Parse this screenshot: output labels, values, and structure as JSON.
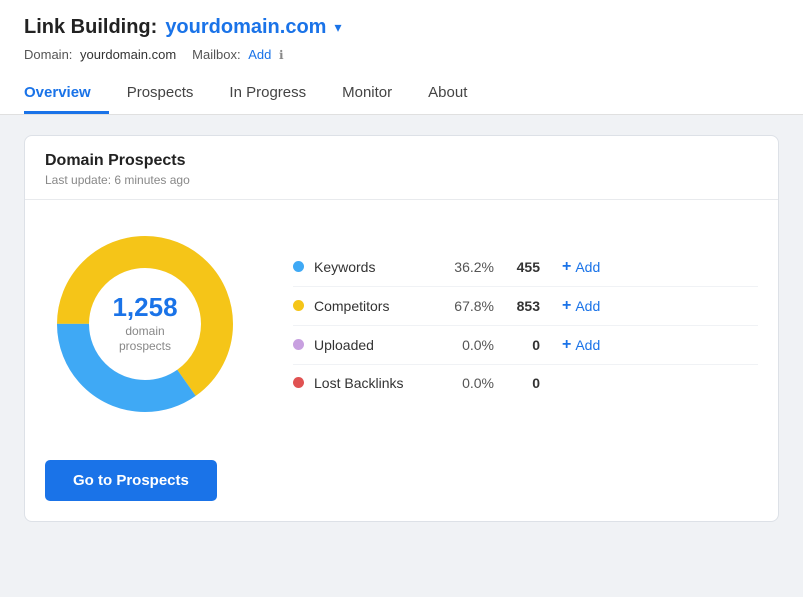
{
  "header": {
    "title_prefix": "Link Building: ",
    "domain": "yourdomain.com",
    "chevron": "▾",
    "meta_domain_label": "Domain:",
    "meta_domain_value": "yourdomain.com",
    "meta_mailbox_label": "Mailbox:",
    "meta_mailbox_add": "Add",
    "info_icon": "ℹ"
  },
  "nav": {
    "tabs": [
      {
        "label": "Overview",
        "active": true
      },
      {
        "label": "Prospects",
        "active": false
      },
      {
        "label": "In Progress",
        "active": false
      },
      {
        "label": "Monitor",
        "active": false
      },
      {
        "label": "About",
        "active": false
      }
    ]
  },
  "card": {
    "title": "Domain Prospects",
    "subtitle": "Last update: 6 minutes ago",
    "donut": {
      "number": "1,258",
      "label_line1": "domain",
      "label_line2": "prospects"
    },
    "legend": [
      {
        "name": "Keywords",
        "color": "#3fa9f5",
        "pct": "36.2%",
        "count": "455",
        "has_add": true
      },
      {
        "name": "Competitors",
        "color": "#f5c518",
        "pct": "67.8%",
        "count": "853",
        "has_add": true
      },
      {
        "name": "Uploaded",
        "color": "#c8a0e0",
        "pct": "0.0%",
        "count": "0",
        "has_add": true
      },
      {
        "name": "Lost Backlinks",
        "color": "#e05252",
        "pct": "0.0%",
        "count": "0",
        "has_add": false
      }
    ],
    "add_label": "Add",
    "go_button": "Go to Prospects"
  }
}
